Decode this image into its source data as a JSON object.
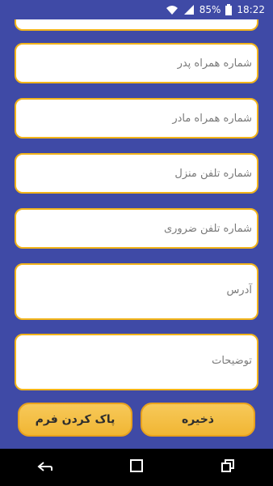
{
  "status_bar": {
    "battery": "85%",
    "time": "18:22"
  },
  "form": {
    "father_mobile_placeholder": "شماره همراه پدر",
    "mother_mobile_placeholder": "شماره همراه مادر",
    "home_phone_placeholder": "شماره تلفن منزل",
    "emergency_phone_placeholder": "شماره تلفن ضروری",
    "address_placeholder": "آدرس",
    "notes_placeholder": "توضیحات"
  },
  "actions": {
    "clear_form_label": "پاک کردن فرم",
    "save_label": "ذخیره"
  },
  "colors": {
    "background": "#3f4aa6",
    "field_border": "#f2b41a",
    "button": "#f1b634"
  }
}
